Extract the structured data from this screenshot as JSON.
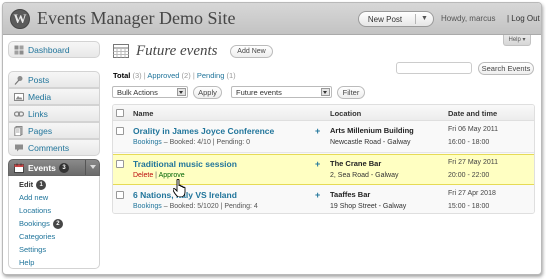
{
  "header": {
    "logo_letter": "W",
    "site_title": "Events Manager Demo Site",
    "new_post_label": "New Post",
    "howdy": "Howdy, marcus",
    "logout": "| Log Out",
    "help_label": "Help ▾"
  },
  "sidebar": {
    "items": [
      {
        "label": "Dashboard",
        "icon": "dashboard-icon"
      },
      {
        "label": "Posts",
        "icon": "pin-icon"
      },
      {
        "label": "Media",
        "icon": "media-icon"
      },
      {
        "label": "Links",
        "icon": "links-icon"
      },
      {
        "label": "Pages",
        "icon": "pages-icon"
      },
      {
        "label": "Comments",
        "icon": "comments-icon"
      },
      {
        "label": "Events",
        "icon": "events-icon",
        "badge": "3",
        "active": true
      }
    ],
    "events_submenu": [
      {
        "label": "Edit",
        "badge": "1",
        "current": true
      },
      {
        "label": "Add new"
      },
      {
        "label": "Locations"
      },
      {
        "label": "Bookings",
        "badge": "2"
      },
      {
        "label": "Categories"
      },
      {
        "label": "Settings"
      },
      {
        "label": "Help"
      }
    ]
  },
  "main": {
    "title": "Future events",
    "add_new": "Add New",
    "filters": {
      "total_label": "Total",
      "total_count": "(3)",
      "approved_label": "Approved",
      "approved_count": "(2)",
      "pending_label": "Pending",
      "pending_count": "(1)",
      "sep": "|"
    },
    "search_value": "",
    "search_button": "Search Events",
    "bulk_actions": "Bulk Actions",
    "apply": "Apply",
    "scope": "Future events",
    "filter": "Filter"
  },
  "table": {
    "headers": {
      "name": "Name",
      "location": "Location",
      "datetime": "Date and time"
    },
    "rows": [
      {
        "name": "Orality in James Joyce Conference",
        "meta_link": "Bookings",
        "meta_text": " – Booked: 4/10 | Pending: 0",
        "plus": "+",
        "loc_name": "Arts Millenium Building",
        "loc_addr": "Newcastle Road - Galway",
        "date": "Fri 06 May 2011",
        "time": "16:00 - 18:00",
        "highlight": false
      },
      {
        "name": "Traditional music session",
        "delete": "Delete",
        "sep": " | ",
        "approve": "Approve",
        "plus": "+",
        "loc_name": "The Crane Bar",
        "loc_addr": "2, Sea Road - Galway",
        "date": "Fri 27 May 2011",
        "time": "20:00 - 22:00",
        "highlight": true
      },
      {
        "name": "6 Nations, Italy VS Ireland",
        "meta_link": "Bookings",
        "meta_text": " – Booked: 5/1020 | Pending: 4",
        "plus": "+",
        "loc_name": "Taaffes Bar",
        "loc_addr": "19 Shop Street - Galway",
        "date": "Fri 27 Apr 2018",
        "time": "15:00 - 18:00",
        "highlight": false
      }
    ]
  },
  "colors": {
    "link": "#21759b",
    "delete": "#bc0b0b",
    "approve": "#006505",
    "highlight_bg": "#ffffc2",
    "menu_active": "#6b6b6b"
  }
}
